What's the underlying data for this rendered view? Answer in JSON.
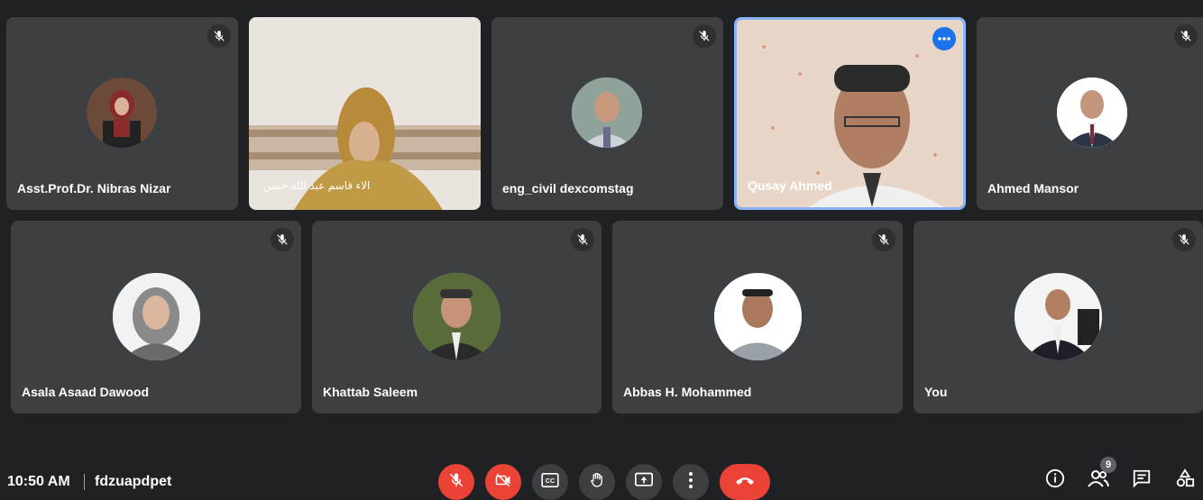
{
  "participants": [
    {
      "name": "Asst.Prof.Dr. Nibras Nizar",
      "muted": true
    },
    {
      "name": "الاء قاسم عبد الله حسن",
      "muted": false
    },
    {
      "name": "eng_civil dexcomstag",
      "muted": true
    },
    {
      "name": "Qusay Ahmed",
      "muted": false
    },
    {
      "name": "Ahmed Mansor",
      "muted": true
    },
    {
      "name": "Asala Asaad Dawood",
      "muted": true
    },
    {
      "name": "Khattab Saleem",
      "muted": true
    },
    {
      "name": "Abbas H. Mohammed",
      "muted": true
    },
    {
      "name": "You",
      "muted": true
    }
  ],
  "footer": {
    "time": "10:50 AM",
    "meeting_code": "fdzuapdpet",
    "participant_count": "9"
  },
  "icons": {
    "mic_off": "mic-off-icon",
    "camera_off": "camera-off-icon",
    "captions": "captions-icon",
    "raise_hand": "hand-icon",
    "present": "present-screen-icon",
    "more": "more-vert-icon",
    "end_call": "end-call-icon",
    "info": "info-icon",
    "people": "people-icon",
    "chat": "chat-icon",
    "activities": "activities-icon"
  },
  "colors": {
    "background": "#202124",
    "tile": "#3c4043",
    "active_border": "#8ab4f8",
    "danger": "#ea4335"
  }
}
